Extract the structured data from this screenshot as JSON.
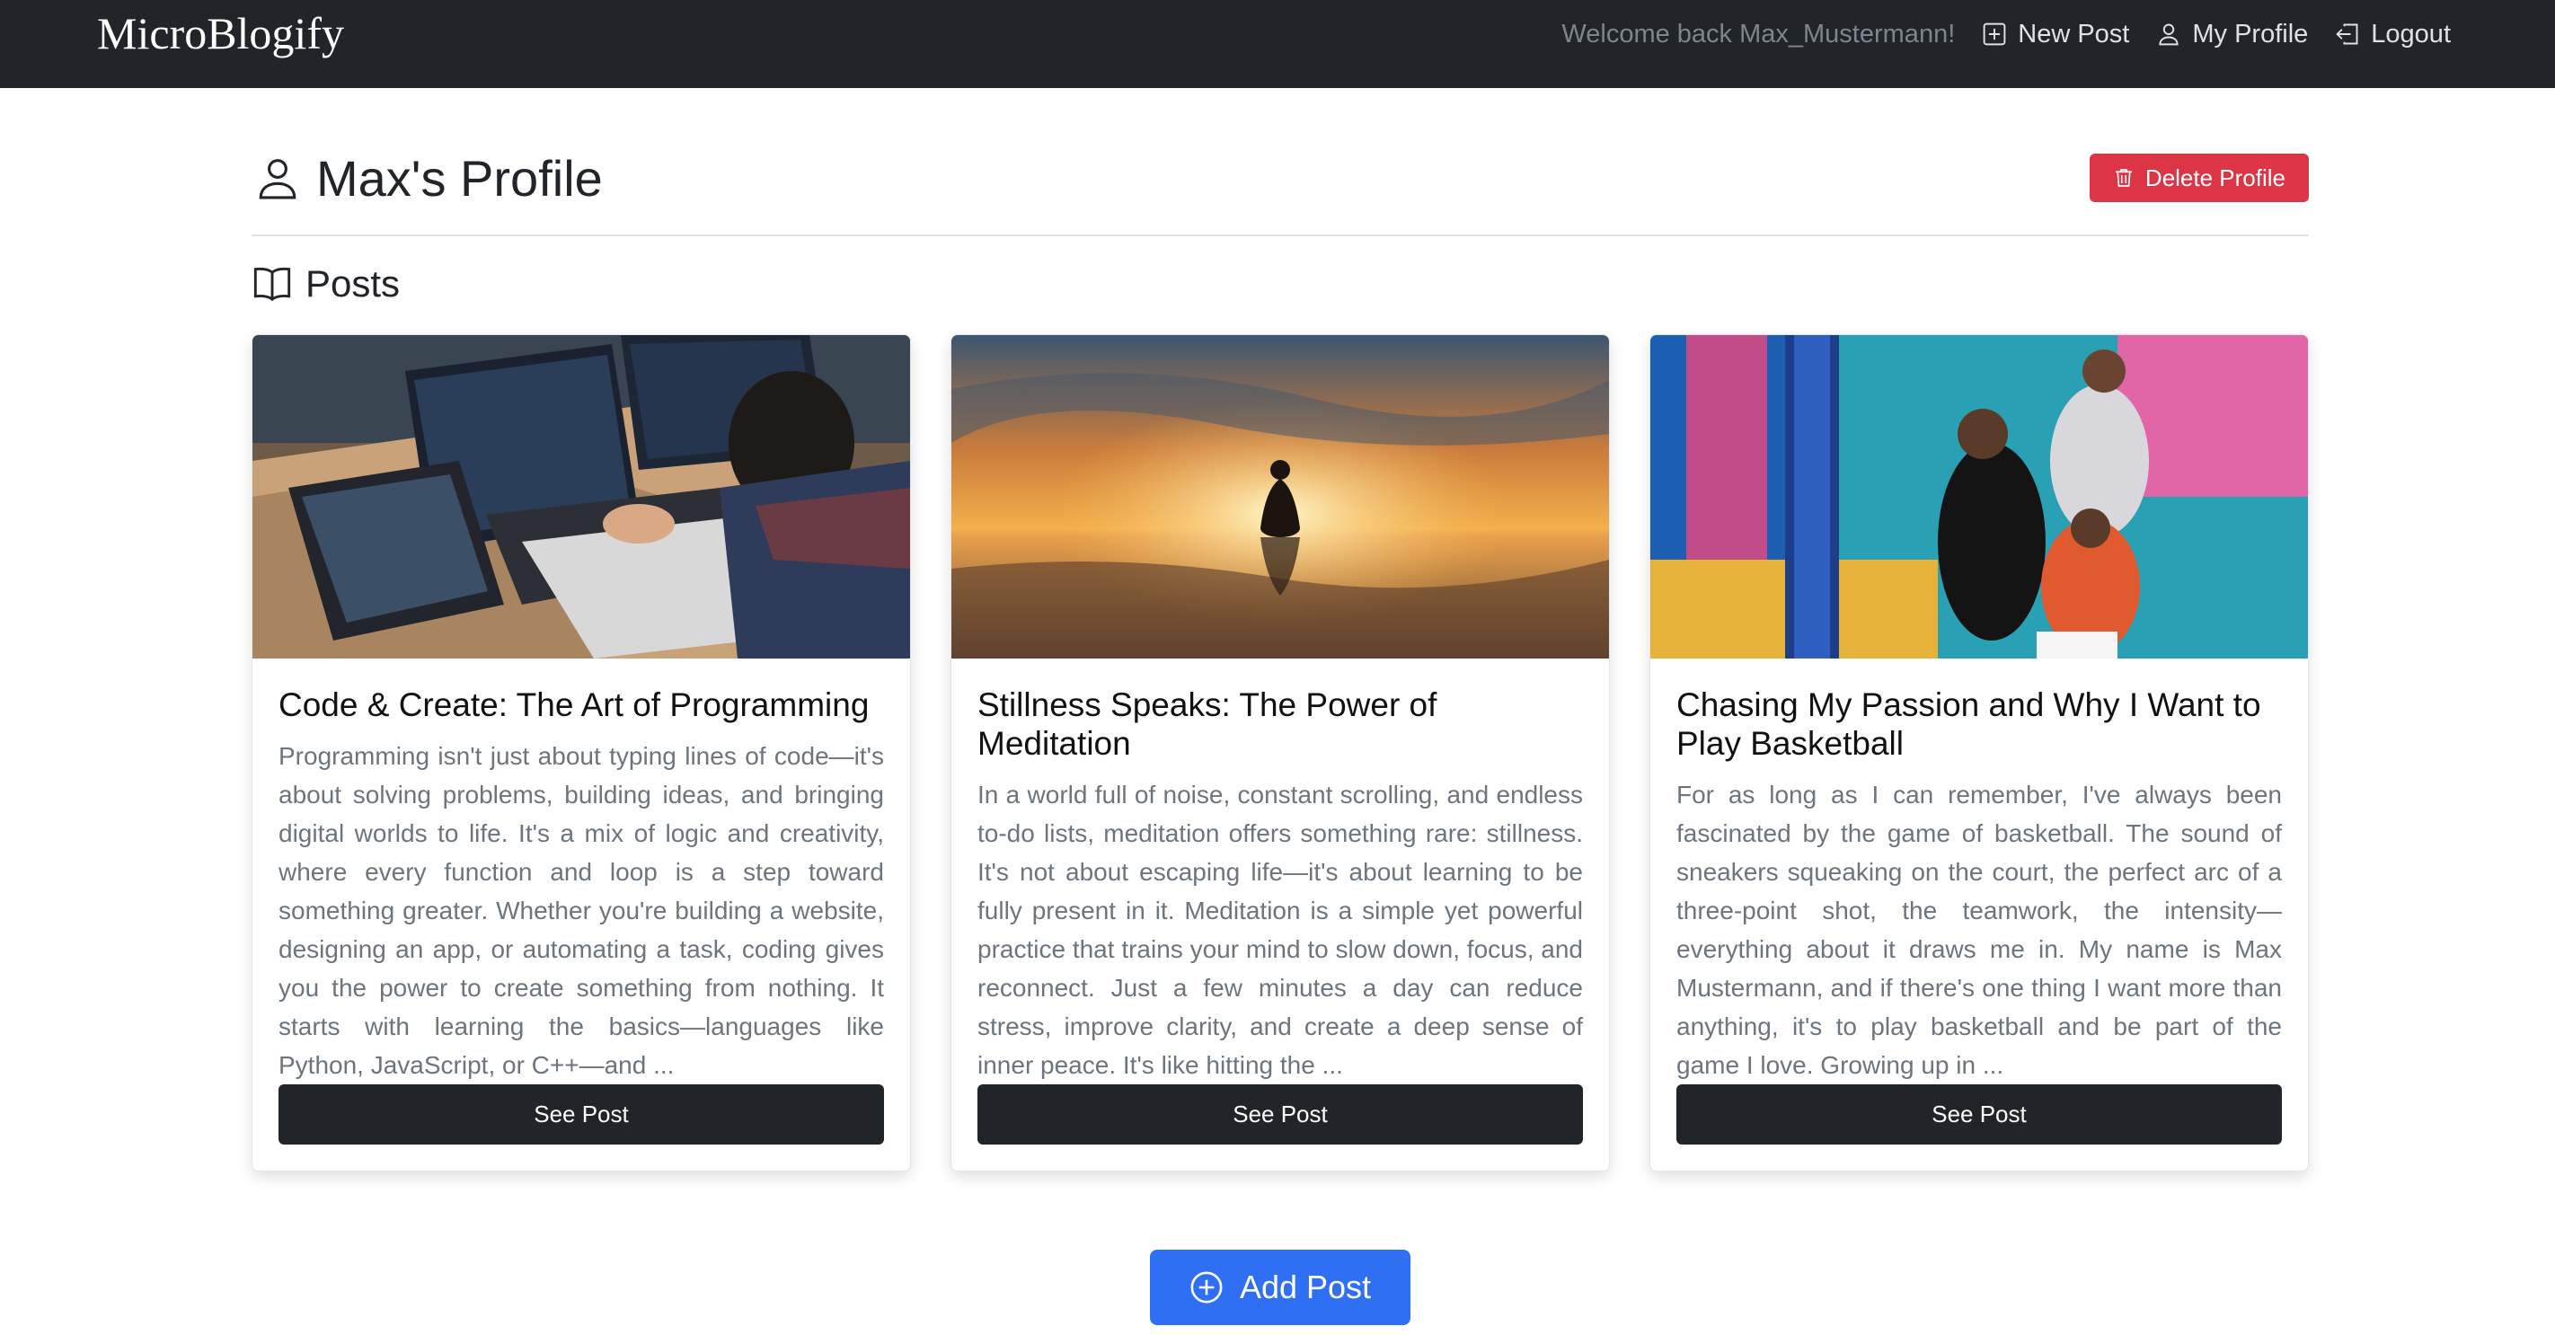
{
  "navbar": {
    "brand": "MicroBlogify",
    "welcome": "Welcome back Max_Mustermann!",
    "new_post": "New Post",
    "my_profile": "My Profile",
    "logout": "Logout"
  },
  "profile": {
    "title": "Max's Profile",
    "delete_label": "Delete Profile"
  },
  "posts_section": {
    "title": "Posts"
  },
  "posts": [
    {
      "image": "programmer-at-laptop-photo",
      "title": "Code & Create: The Art of Programming",
      "excerpt": "Programming isn't just about typing lines of code—it's about solving problems, building ideas, and bringing digital worlds to life. It's a mix of logic and creativity, where every function and loop is a step toward something greater. Whether you're building a website, designing an app, or automating a task, coding gives you the power to create something from nothing. It starts with learning the basics—languages like Python, JavaScript, or C++—and ...",
      "button": "See Post"
    },
    {
      "image": "meditation-sunset-photo",
      "title": "Stillness Speaks: The Power of Meditation",
      "excerpt": "In a world full of noise, constant scrolling, and endless to-do lists, meditation offers something rare: stillness. It's not about escaping life—it's about learning to be fully present in it. Meditation is a simple yet powerful practice that trains your mind to slow down, focus, and reconnect. Just a few minutes a day can reduce stress, improve clarity, and create a deep sense of inner peace. It's like hitting the ...",
      "button": "See Post"
    },
    {
      "image": "basketball-players-photo",
      "title": "Chasing My Passion and Why I Want to Play Basketball",
      "excerpt": "For as long as I can remember, I've always been fascinated by the game of basketball. The sound of sneakers squeaking on the court, the perfect arc of a three-point shot, the teamwork, the intensity—everything about it draws me in. My name is Max Mustermann, and if there's one thing I want more than anything, it's to play basketball and be part of the game I love. Growing up in ...",
      "button": "See Post"
    }
  ],
  "add_post": "Add Post",
  "colors": {
    "navbar": "#212529",
    "danger": "#dc3545",
    "primary": "#2f6ff4",
    "muted_text": "#6c757d"
  }
}
